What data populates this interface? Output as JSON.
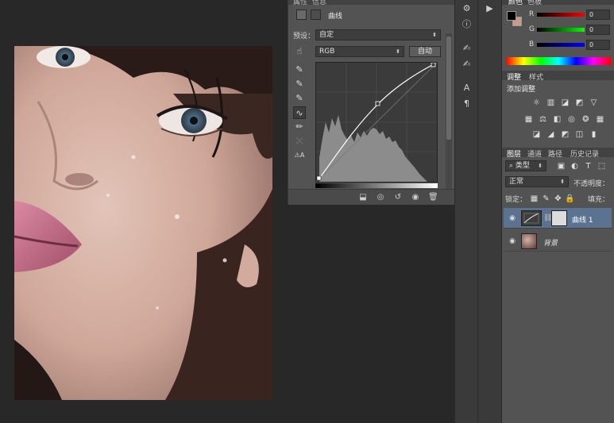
{
  "properties_panel": {
    "tabs": [
      "属性",
      "信息"
    ],
    "adjustment_title": "曲线",
    "preset_label": "预设：",
    "preset_value": "自定",
    "channel_value": "RGB",
    "auto_button": "自动"
  },
  "color_panel": {
    "title": "颜色",
    "extra_tab": "色板",
    "channels": [
      {
        "label": "R",
        "value": "0"
      },
      {
        "label": "G",
        "value": "0"
      },
      {
        "label": "B",
        "value": "0"
      }
    ],
    "foreground_color": "#000000",
    "background_color": "#c89b8a"
  },
  "adjustments_panel": {
    "tabs": [
      "调整",
      "样式"
    ],
    "heading": "添加调整"
  },
  "layers_panel": {
    "tabs": [
      "图层",
      "通道",
      "路径",
      "历史记录"
    ],
    "filter_label": "类型",
    "blend_mode": "正常",
    "opacity_label": "不透明度：",
    "lock_label": "锁定：",
    "fill_label": "填充：",
    "layers": [
      {
        "name": "曲线 1",
        "selected": true
      },
      {
        "name": "背景",
        "selected": false
      }
    ]
  },
  "colors": {
    "app_bg": "#282828",
    "panel_bg": "#535353",
    "selected_row": "#5b7290"
  }
}
